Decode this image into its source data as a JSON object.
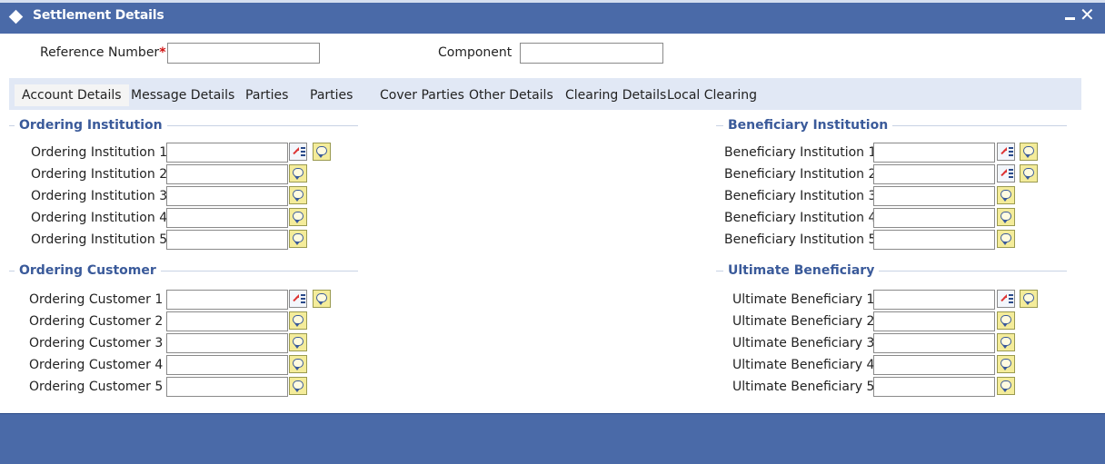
{
  "window": {
    "title": "Settlement Details",
    "minimize_symbol": "—",
    "close_symbol": "✕"
  },
  "header": {
    "reference_number_label": "Reference Number",
    "required_mark": "*",
    "reference_number_value": "",
    "component_label": "Component",
    "component_value": ""
  },
  "tabs": [
    {
      "label": "Account Details"
    },
    {
      "label": "Message Details"
    },
    {
      "label": "Parties"
    },
    {
      "label": "Parties"
    },
    {
      "label": "Cover Parties"
    },
    {
      "label": "Other Details"
    },
    {
      "label": "Clearing Details"
    },
    {
      "label": "Local Clearing"
    }
  ],
  "sections": {
    "ordering_institution": {
      "title": "Ordering Institution",
      "fields": [
        "Ordering Institution 1",
        "Ordering Institution 2",
        "Ordering Institution 3",
        "Ordering Institution 4",
        "Ordering Institution 5"
      ]
    },
    "beneficiary_institution": {
      "title": "Beneficiary Institution",
      "fields": [
        "Beneficiary Institution 1",
        "Beneficiary Institution 2",
        "Beneficiary Institution 3",
        "Beneficiary Institution 4",
        "Beneficiary Institution 5"
      ]
    },
    "ordering_customer": {
      "title": "Ordering Customer",
      "fields": [
        "Ordering Customer 1",
        "Ordering Customer 2",
        "Ordering Customer 3",
        "Ordering Customer 4",
        "Ordering Customer 5"
      ]
    },
    "ultimate_beneficiary": {
      "title": "Ultimate Beneficiary",
      "fields": [
        "Ultimate Beneficiary 1",
        "Ultimate Beneficiary 2",
        "Ultimate Beneficiary 3",
        "Ultimate Beneficiary 4",
        "Ultimate Beneficiary 5"
      ]
    }
  },
  "icons": {
    "lov": "list-of-values-icon",
    "note": "speech-bubble-icon"
  },
  "colors": {
    "title_bar": "#4a6aa8",
    "section_title": "#3a5a9a",
    "tab_bar": "#e1e8f5",
    "required": "#d01010"
  }
}
